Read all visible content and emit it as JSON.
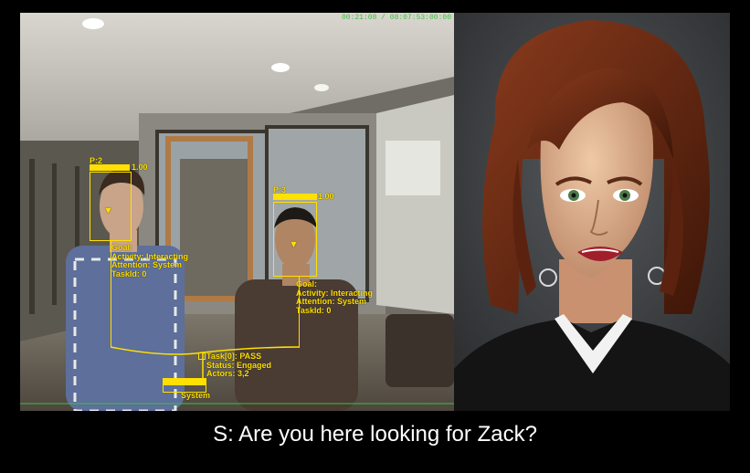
{
  "camera": {
    "timestamp": "00:21:08 / 08:07:53:00:00",
    "people": [
      {
        "id_label": "P:2",
        "confidence": "1.00",
        "info": [
          "Goal:",
          "Activity: Interacting",
          "Attention: System",
          "TaskId: 0"
        ]
      },
      {
        "id_label": "P:3",
        "confidence": "1.00",
        "info": [
          "Goal:",
          "Activity: Interacting",
          "Attention: System",
          "TaskId: 0"
        ]
      }
    ],
    "task": {
      "lines": [
        "Task[0]: PASS",
        "Status: Engaged",
        "Actors: 3,2"
      ]
    },
    "system_label": "System"
  },
  "caption": {
    "text": "S: Are you here looking for Zack?"
  },
  "colors": {
    "overlay": "#ffe000",
    "timestamp": "#3fbf3f"
  }
}
